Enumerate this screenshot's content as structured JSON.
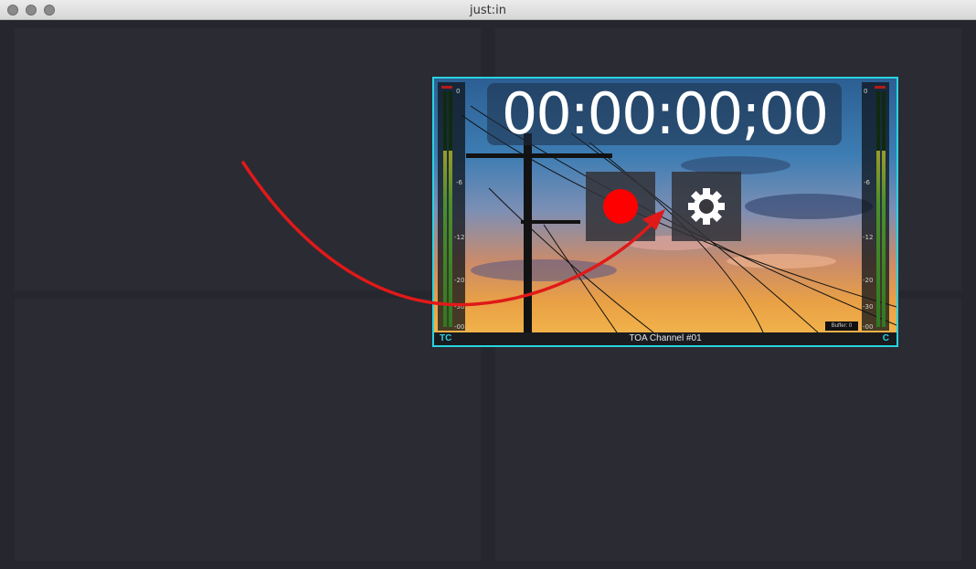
{
  "window": {
    "title": "just:in"
  },
  "channel": {
    "timecode": "00:00:00;00",
    "name": "TOA Channel #01",
    "left_tag": "TC",
    "right_tag": "C",
    "buffer_label": "Buffer: 0",
    "meter_ticks": [
      "0",
      "-6",
      "-12",
      "-20",
      "-30",
      "-00"
    ],
    "meter_level_fraction": 0.75,
    "accent_color": "#29d3e0",
    "record_color": "#ff0000"
  },
  "icons": {
    "record": "record-icon",
    "settings": "gear-icon"
  },
  "annotation": {
    "arrow_color": "#e01919"
  }
}
